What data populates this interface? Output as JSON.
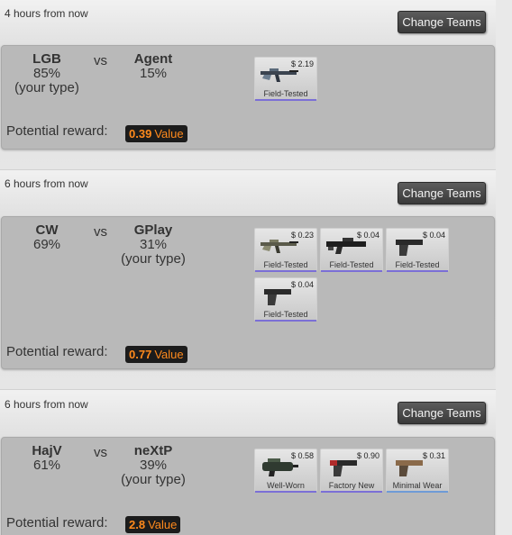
{
  "vs_label": "vs",
  "reward_label": "Potential reward:",
  "change_teams_label": "Change Teams",
  "wear_colors": {
    "Field-Tested": "#7b6fd6",
    "Well-Worn": "#7b6fd6",
    "Factory New": "#7b6fd6",
    "Minimal Wear": "#6e9bd6"
  },
  "matches": [
    {
      "time": "4 hours from now",
      "team1": {
        "name": "LGB",
        "percent": "85%",
        "note": "(your type)"
      },
      "team2": {
        "name": "Agent",
        "percent": "15%",
        "note": ""
      },
      "reward_value": "0.39",
      "reward_unit": "Value",
      "items": [
        {
          "price": "$ 2.19",
          "wear": "Field-Tested",
          "icon": "ak47-icon"
        }
      ]
    },
    {
      "time": "6 hours from now",
      "team1": {
        "name": "CW",
        "percent": "69%",
        "note": ""
      },
      "team2": {
        "name": "GPlay",
        "percent": "31%",
        "note": "(your type)"
      },
      "reward_value": "0.77",
      "reward_unit": "Value",
      "items": [
        {
          "price": "$ 0.23",
          "wear": "Field-Tested",
          "icon": "ak47-icon"
        },
        {
          "price": "$ 0.04",
          "wear": "Field-Tested",
          "icon": "scar-icon"
        },
        {
          "price": "$ 0.04",
          "wear": "Field-Tested",
          "icon": "pistol-icon"
        },
        {
          "price": "$ 0.04",
          "wear": "Field-Tested",
          "icon": "pistol-icon"
        }
      ]
    },
    {
      "time": "6 hours from now",
      "team1": {
        "name": "HajV",
        "percent": "61%",
        "note": ""
      },
      "team2": {
        "name": "neXtP",
        "percent": "39%",
        "note": "(your type)"
      },
      "reward_value": "2.8",
      "reward_unit": "Value",
      "items": [
        {
          "price": "$ 0.58",
          "wear": "Well-Worn",
          "icon": "p90-icon"
        },
        {
          "price": "$ 0.90",
          "wear": "Factory New",
          "icon": "pistol-icon"
        },
        {
          "price": "$ 0.31",
          "wear": "Minimal Wear",
          "icon": "pistol-tan-icon"
        }
      ]
    }
  ]
}
